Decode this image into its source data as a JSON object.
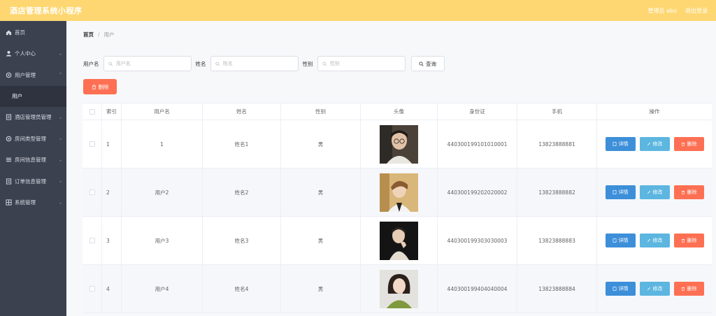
{
  "header": {
    "title": "酒店管理系统小程序",
    "admin": "管理员 abo",
    "logout": "退出登录"
  },
  "sidebar": {
    "items": [
      {
        "label": "首页",
        "icon": "home-icon",
        "has_children": false
      },
      {
        "label": "个人中心",
        "icon": "user-icon",
        "has_children": true
      },
      {
        "label": "用户管理",
        "icon": "gear-icon",
        "has_children": true
      },
      {
        "label": "酒店管理员管理",
        "icon": "list-icon",
        "has_children": true
      },
      {
        "label": "房间类型管理",
        "icon": "gear-icon",
        "has_children": true
      },
      {
        "label": "房间信息管理",
        "icon": "menu-icon",
        "has_children": true
      },
      {
        "label": "订单信息管理",
        "icon": "list-icon",
        "has_children": true
      },
      {
        "label": "系统管理",
        "icon": "grid-icon",
        "has_children": true
      }
    ],
    "active_sub": "用户"
  },
  "breadcrumb": {
    "home": "首页",
    "separator": "/",
    "current": "用户"
  },
  "search": {
    "username_label": "用户名",
    "username_placeholder": "用户名",
    "name_label": "姓名",
    "name_placeholder": "姓名",
    "sex_label": "性别",
    "sex_placeholder": "性别",
    "query_label": "查询"
  },
  "toolbar": {
    "delete_label": "删除"
  },
  "table": {
    "columns": [
      "索引",
      "用户名",
      "姓名",
      "性别",
      "头像",
      "身份证",
      "手机",
      "操作"
    ],
    "actions": {
      "detail": "详情",
      "edit": "修改",
      "delete": "删除"
    },
    "rows": [
      {
        "index": "1",
        "username": "1",
        "name": "姓名1",
        "sex": "男",
        "id_card": "440300199101010001",
        "phone": "13823888881"
      },
      {
        "index": "2",
        "username": "用户2",
        "name": "姓名2",
        "sex": "男",
        "id_card": "440300199202020002",
        "phone": "13823888882"
      },
      {
        "index": "3",
        "username": "用户3",
        "name": "姓名3",
        "sex": "男",
        "id_card": "440300199303030003",
        "phone": "13823888883"
      },
      {
        "index": "4",
        "username": "用户4",
        "name": "姓名4",
        "sex": "男",
        "id_card": "440300199404040004",
        "phone": "13823888884"
      }
    ]
  },
  "colors": {
    "topbar": "#fed772",
    "sidebar": "#3c4150",
    "danger": "#fe7053",
    "primary": "#3d8fd9",
    "info": "#5cb6e0"
  }
}
